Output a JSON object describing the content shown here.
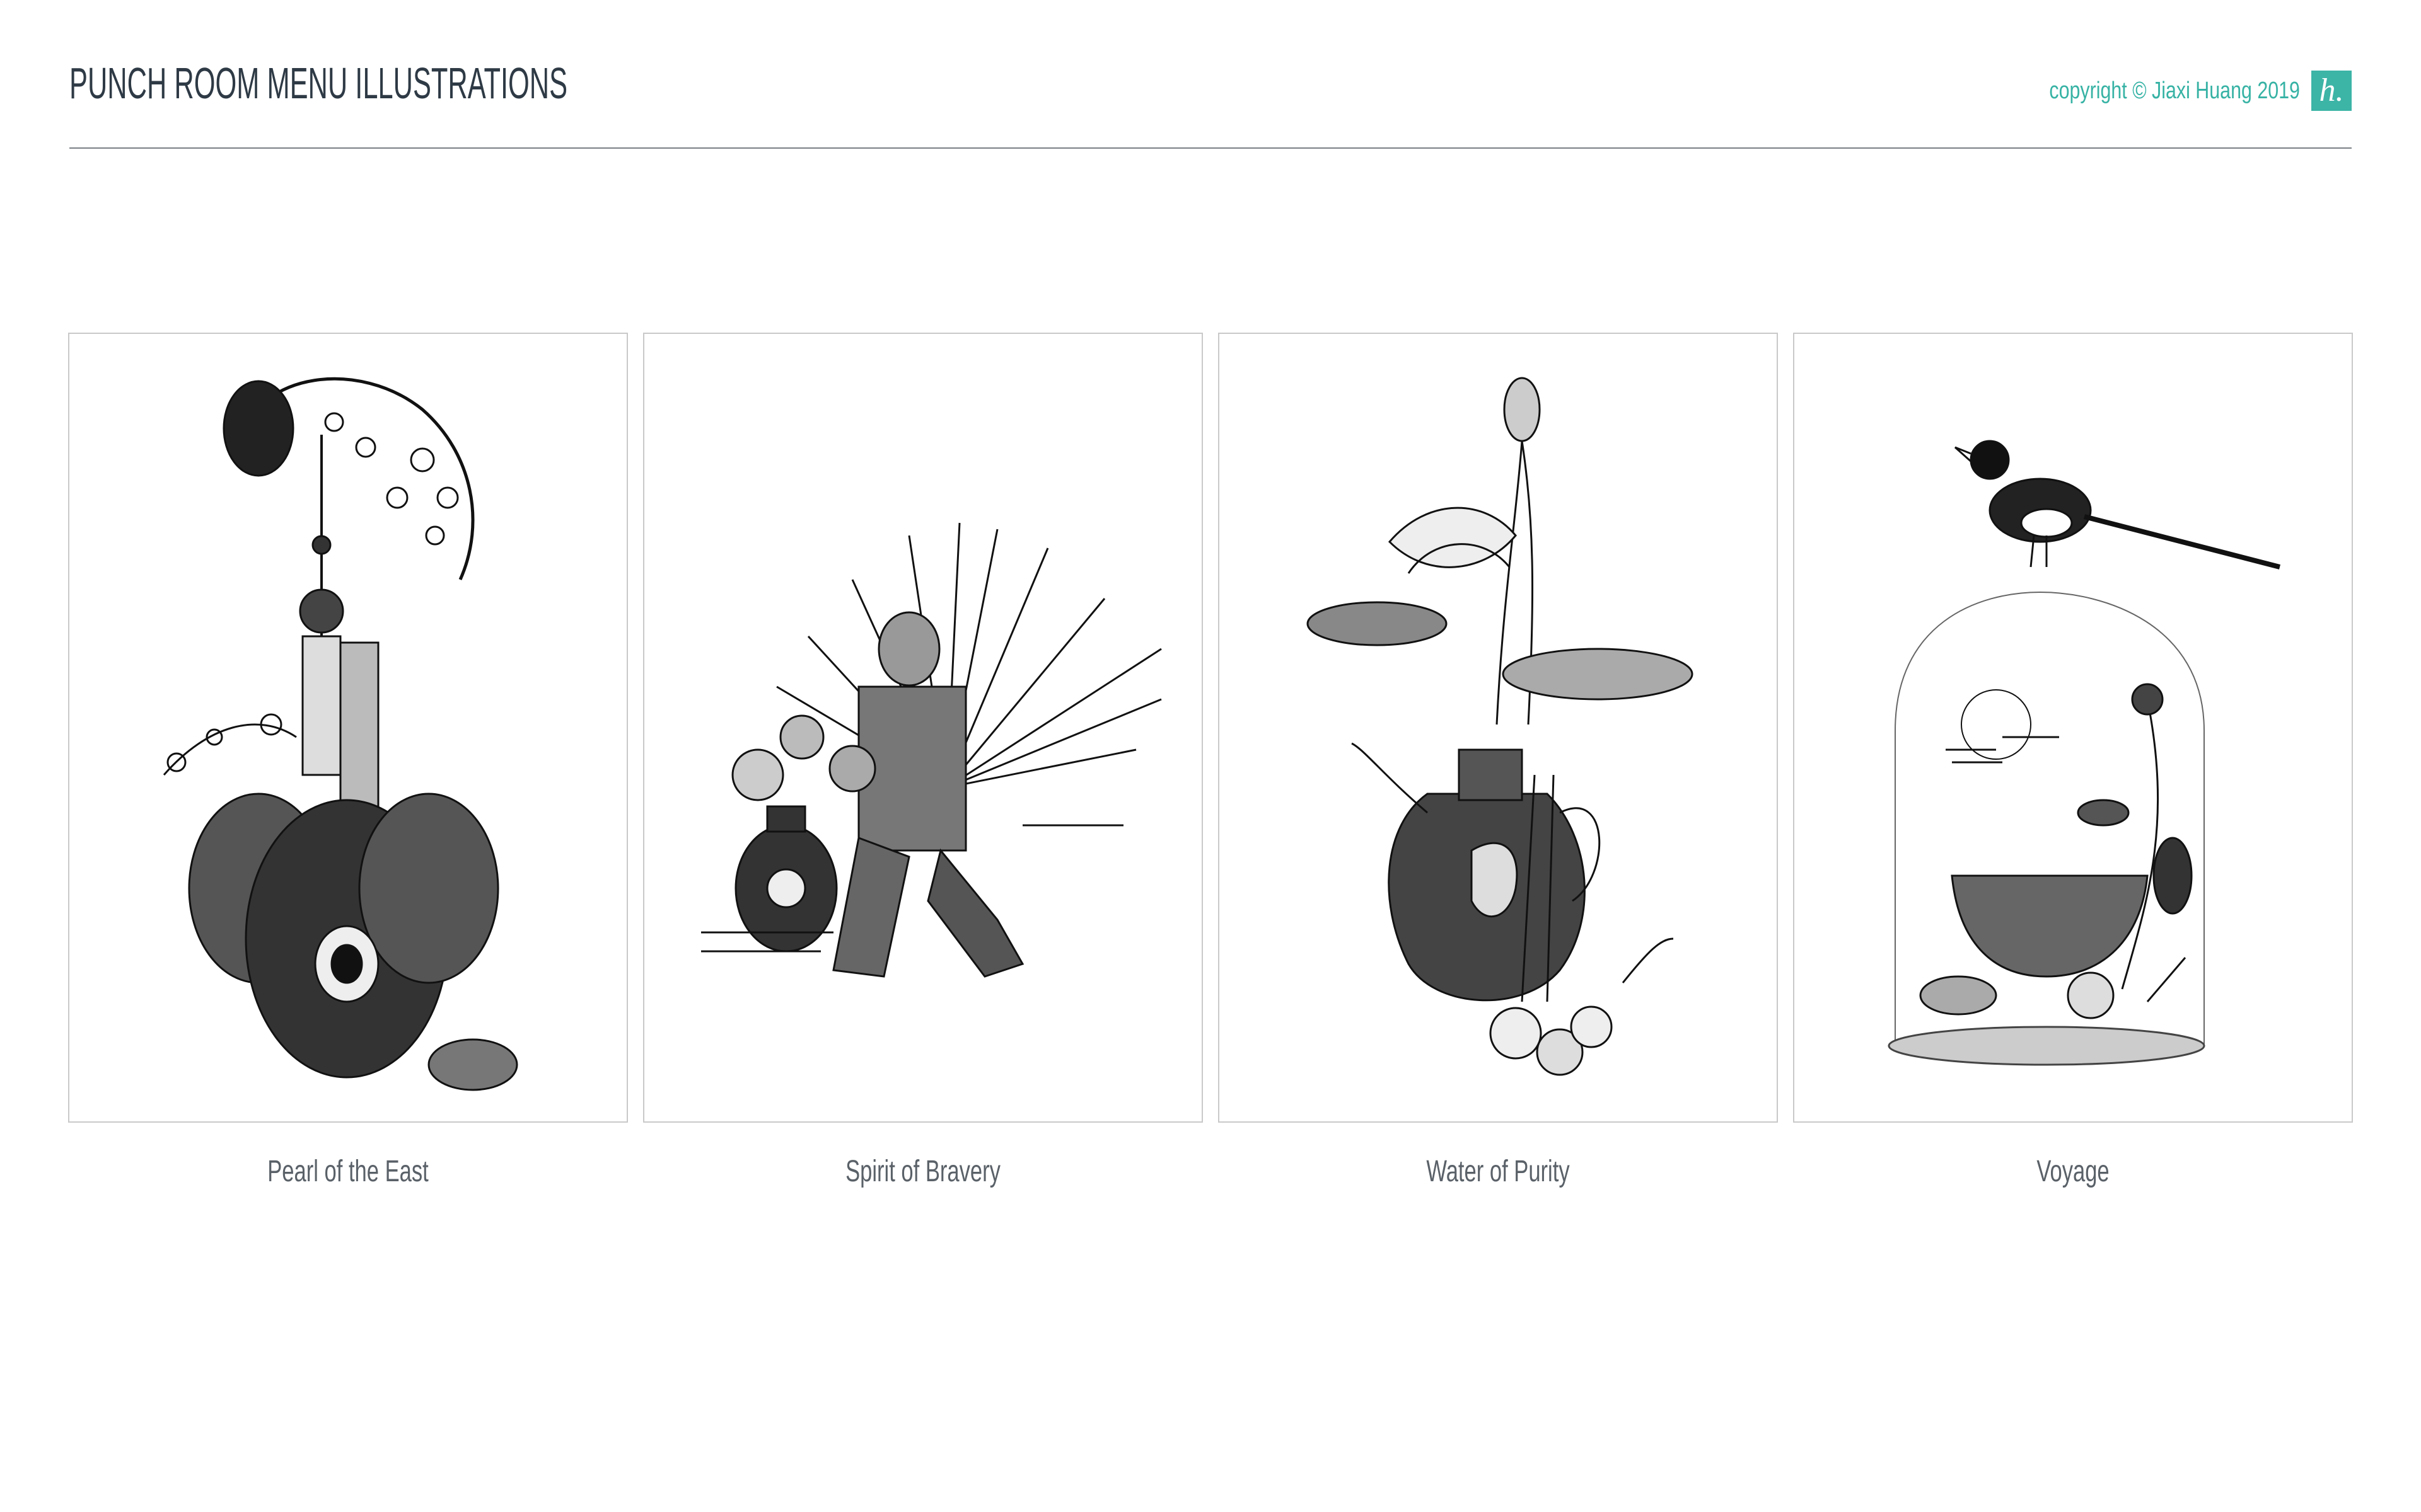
{
  "header": {
    "title": "PUNCH ROOM MENU ILLUSTRATIONS",
    "copyright": "copyright © Jiaxi Huang 2019",
    "logo_text": "h."
  },
  "colors": {
    "accent": "#3cb4a6",
    "title": "#2e3a45",
    "caption": "#5a6168",
    "frame_border": "#c9c9c9"
  },
  "gallery": {
    "items": [
      {
        "caption": "Pearl of the East",
        "illustration": "peacock-tower-vase-illustration"
      },
      {
        "caption": "Spirit of Bravery",
        "illustration": "terracotta-warrior-agave-illustration"
      },
      {
        "caption": "Water of Purity",
        "illustration": "lotus-ewer-illustration"
      },
      {
        "caption": "Voyage",
        "illustration": "magpie-bell-jar-illustration"
      }
    ]
  }
}
